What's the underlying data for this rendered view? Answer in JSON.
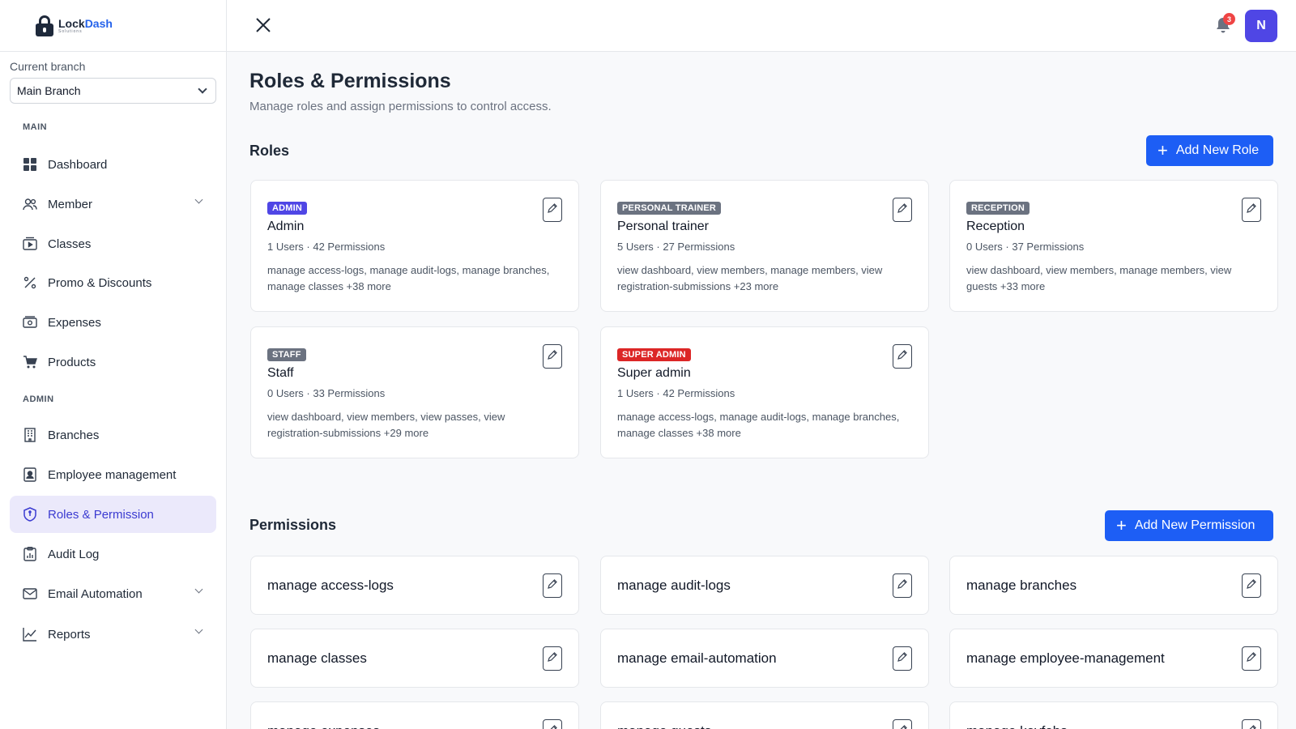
{
  "brand": {
    "name_part1": "Lock",
    "name_part2": "Dash",
    "tagline": "Solutions"
  },
  "sidebar": {
    "branch_label": "Current branch",
    "branch_value": "Main Branch",
    "section_main": "MAIN",
    "section_admin": "ADMIN",
    "items": [
      {
        "label": "Dashboard",
        "icon": "grid-icon"
      },
      {
        "label": "Member",
        "icon": "users-icon",
        "expandable": true
      },
      {
        "label": "Classes",
        "icon": "classes-icon"
      },
      {
        "label": "Promo & Discounts",
        "icon": "percent-icon"
      },
      {
        "label": "Expenses",
        "icon": "wallet-icon"
      },
      {
        "label": "Products",
        "icon": "cart-icon"
      },
      {
        "label": "Branches",
        "icon": "building-icon"
      },
      {
        "label": "Employee management",
        "icon": "badge-icon"
      },
      {
        "label": "Roles & Permission",
        "icon": "shield-icon",
        "active": true
      },
      {
        "label": "Audit Log",
        "icon": "clipboard-icon"
      },
      {
        "label": "Email Automation",
        "icon": "mail-icon",
        "expandable": true
      },
      {
        "label": "Reports",
        "icon": "chart-icon",
        "expandable": true
      }
    ]
  },
  "topbar": {
    "notification_count": "3",
    "avatar_initial": "N"
  },
  "page": {
    "title": "Roles & Permissions",
    "subtitle": "Manage roles and assign permissions to control access."
  },
  "roles_section": {
    "title": "Roles",
    "add_label": "Add New Role",
    "roles": [
      {
        "badge": "ADMIN",
        "badge_color": "#4f46e5",
        "name": "Admin",
        "meta": "1 Users · 42 Permissions",
        "perms": "manage access-logs, manage audit-logs, manage branches, manage classes +38 more"
      },
      {
        "badge": "PERSONAL TRAINER",
        "badge_color": "#6b7280",
        "name": "Personal trainer",
        "meta": "5 Users · 27 Permissions",
        "perms": "view dashboard, view members, manage members, view registration-submissions +23 more"
      },
      {
        "badge": "RECEPTION",
        "badge_color": "#6b7280",
        "name": "Reception",
        "meta": "0 Users · 37 Permissions",
        "perms": "view dashboard, view members, manage members, view guests +33 more"
      },
      {
        "badge": "STAFF",
        "badge_color": "#6b7280",
        "name": "Staff",
        "meta": "0 Users · 33 Permissions",
        "perms": "view dashboard, view members, view passes, view registration-submissions +29 more"
      },
      {
        "badge": "SUPER ADMIN",
        "badge_color": "#dc2626",
        "name": "Super admin",
        "meta": "1 Users · 42 Permissions",
        "perms": "manage access-logs, manage audit-logs, manage branches, manage classes +38 more"
      }
    ]
  },
  "permissions_section": {
    "title": "Permissions",
    "add_label": "Add New Permission",
    "permissions": [
      "manage access-logs",
      "manage audit-logs",
      "manage branches",
      "manage classes",
      "manage email-automation",
      "manage employee-management",
      "manage expenses",
      "manage guests",
      "manage keyfobs"
    ]
  }
}
